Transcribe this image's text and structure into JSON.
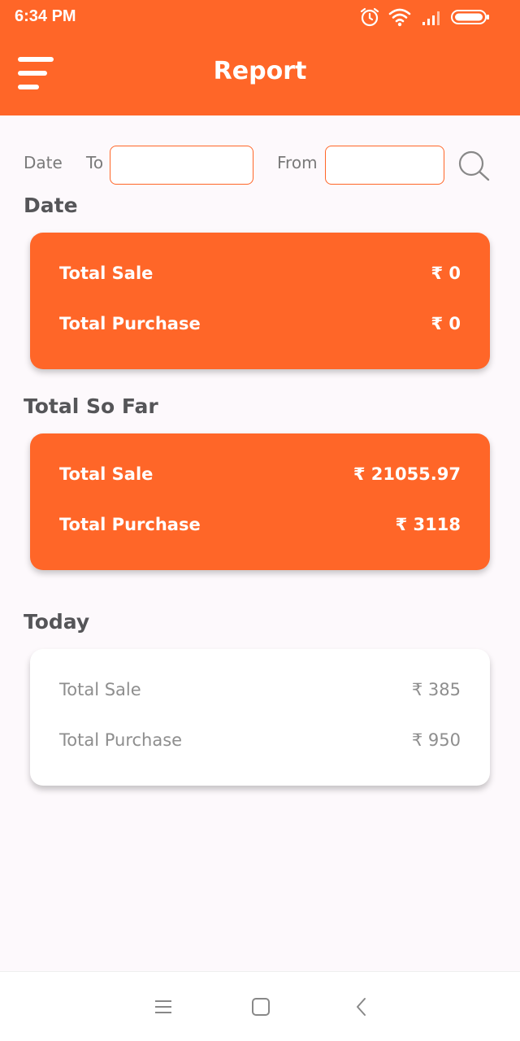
{
  "status_bar": {
    "time": "6:34 PM",
    "icons": [
      "alarm-icon",
      "wifi-icon",
      "signal-icon",
      "battery-icon"
    ]
  },
  "app_bar": {
    "title": "Report",
    "menu_icon": "menu-icon",
    "color": "#ff6628"
  },
  "filter": {
    "date_label": "Date",
    "to_label": "To",
    "to_value": "",
    "from_label": "From",
    "from_value": "",
    "search_icon": "search-icon"
  },
  "sections": {
    "date": {
      "title": "Date",
      "total_sale_label": "Total Sale",
      "total_sale_value": "₹ 0",
      "total_purchase_label": "Total Purchase",
      "total_purchase_value": "₹ 0"
    },
    "total_so_far": {
      "title": "Total So Far",
      "total_sale_label": "Total Sale",
      "total_sale_value": "₹ 21055.97",
      "total_purchase_label": "Total Purchase",
      "total_purchase_value": "₹ 3118"
    },
    "today": {
      "title": "Today",
      "total_sale_label": "Total Sale",
      "total_sale_value": "₹ 385",
      "total_purchase_label": "Total Purchase",
      "total_purchase_value": "₹ 950"
    }
  },
  "nav_bar": {
    "icons": [
      "recents-icon",
      "home-icon",
      "back-icon"
    ]
  }
}
